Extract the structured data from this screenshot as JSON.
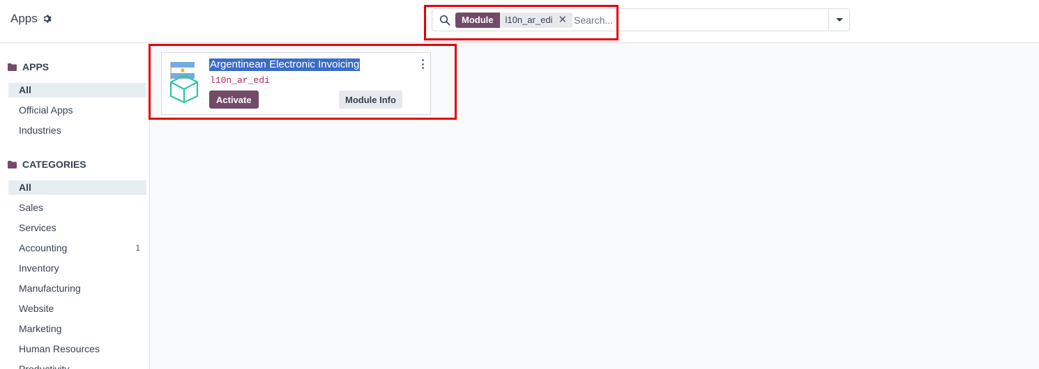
{
  "header": {
    "breadcrumb": "Apps",
    "icons": {
      "settings": "gear-icon",
      "search": "search-icon",
      "toggle": "caret-down-icon"
    }
  },
  "search": {
    "facet_label": "Module",
    "facet_value": "l10n_ar_edi",
    "placeholder": "Search..."
  },
  "sidebar": {
    "apps_title": "APPS",
    "apps": [
      {
        "label": "All",
        "active": true
      },
      {
        "label": "Official Apps"
      },
      {
        "label": "Industries"
      }
    ],
    "categories_title": "CATEGORIES",
    "categories": [
      {
        "label": "All",
        "active": true
      },
      {
        "label": "Sales"
      },
      {
        "label": "Services"
      },
      {
        "label": "Accounting",
        "count": "1"
      },
      {
        "label": "Inventory"
      },
      {
        "label": "Manufacturing"
      },
      {
        "label": "Website"
      },
      {
        "label": "Marketing"
      },
      {
        "label": "Human Resources"
      },
      {
        "label": "Productivity"
      }
    ]
  },
  "card": {
    "title": "Argentinean Electronic Invoicing",
    "technical_name": "l10n_ar_edi",
    "activate_label": "Activate",
    "info_label": "Module Info",
    "icon": "argentina-flag-box-icon"
  },
  "colors": {
    "brand": "#714b67",
    "highlight": "#e5000a",
    "selection": "#3a6cc7"
  }
}
